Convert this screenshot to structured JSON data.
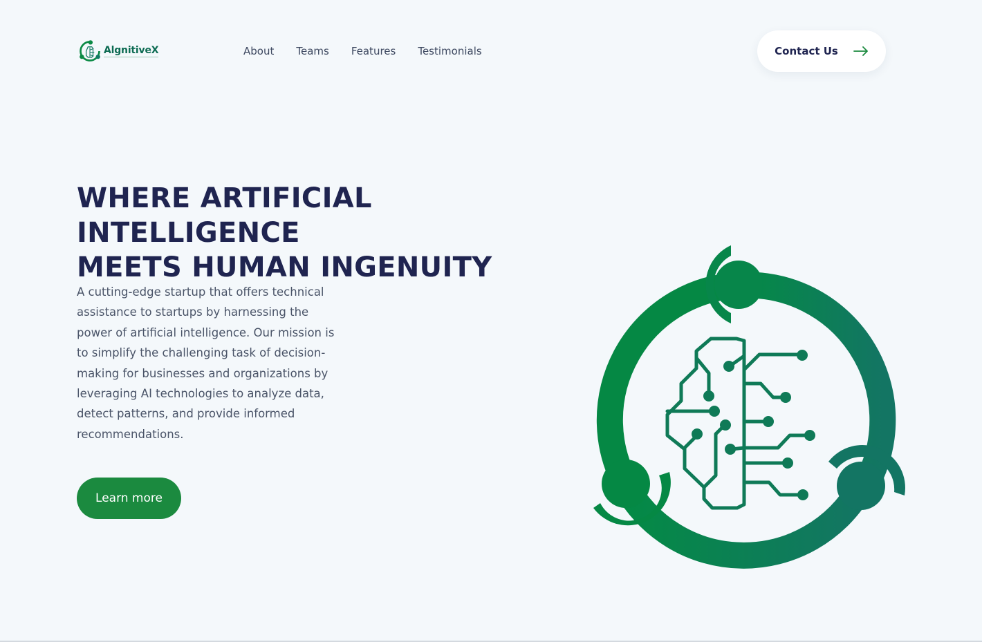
{
  "brand": {
    "logo_text": "AlgnitiveX"
  },
  "nav": {
    "items": [
      {
        "label": "About"
      },
      {
        "label": "Teams"
      },
      {
        "label": "Features"
      },
      {
        "label": "Testimonials"
      }
    ]
  },
  "header": {
    "contact_label": "Contact Us",
    "contact_icon": "arrow-right-icon"
  },
  "hero": {
    "title_line1": "WHERE ARTIFICIAL INTELLIGENCE",
    "title_line2": "MEETS HUMAN INGENUITY",
    "description": "A cutting-edge startup that offers technical assistance to startups by harnessing the power of artificial intelligence. Our mission is to simplify the challenging task of decision-making for businesses and organizations by leveraging AI technologies to analyze data, detect patterns, and provide informed recommendations.",
    "cta_label": "Learn more",
    "graphic_icon": "ai-brain-circuit-icon"
  },
  "colors": {
    "background": "#f4f8fb",
    "primary_green": "#1b8a3f",
    "teal": "#137a63",
    "heading": "#1f2450",
    "body_text": "#4a5468"
  }
}
